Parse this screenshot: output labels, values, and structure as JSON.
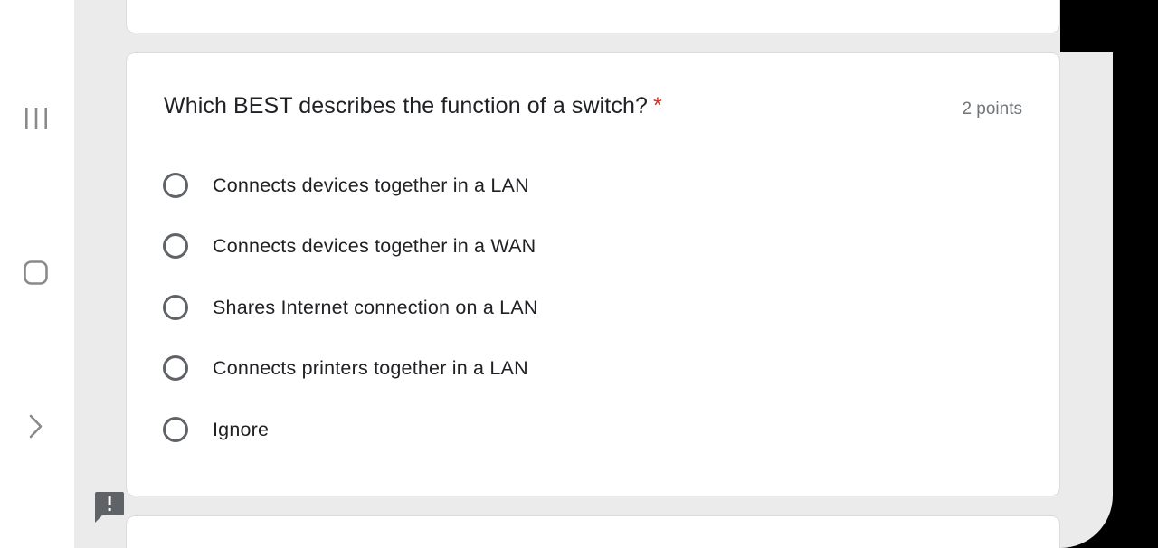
{
  "nav": {
    "recents_icon": "recents-icon",
    "home_icon": "home-icon",
    "back_icon": "back-chevron-icon"
  },
  "question": {
    "title": "Which BEST describes the function of a switch?",
    "required_mark": "*",
    "points": "2 points",
    "options": [
      {
        "label": "Connects devices together in a LAN",
        "selected": false
      },
      {
        "label": "Connects devices together in a WAN",
        "selected": false
      },
      {
        "label": "Shares Internet connection on a LAN",
        "selected": false
      },
      {
        "label": "Connects printers together in a LAN",
        "selected": false
      },
      {
        "label": "Ignore",
        "selected": false
      }
    ]
  },
  "feedback": {
    "icon": "feedback-icon"
  },
  "colors": {
    "background": "#ebebeb",
    "card": "#ffffff",
    "required": "#d93025",
    "radio_border": "#5f6368",
    "text": "#202124",
    "secondary_text": "#70757a"
  }
}
